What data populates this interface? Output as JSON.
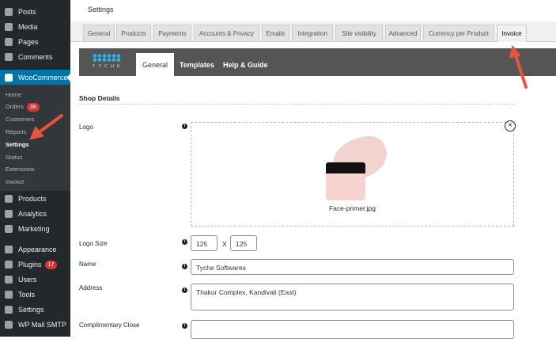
{
  "sidebar": {
    "items": [
      {
        "label": "Posts"
      },
      {
        "label": "Media"
      },
      {
        "label": "Pages"
      },
      {
        "label": "Comments"
      },
      {
        "label": "WooCommerce"
      },
      {
        "label": "Products"
      },
      {
        "label": "Analytics"
      },
      {
        "label": "Marketing"
      },
      {
        "label": "Appearance"
      },
      {
        "label": "Plugins",
        "badge": "17"
      },
      {
        "label": "Users"
      },
      {
        "label": "Tools"
      },
      {
        "label": "Settings"
      },
      {
        "label": "WP Mail SMTP"
      }
    ],
    "submenu": [
      {
        "label": "Home"
      },
      {
        "label": "Orders",
        "badge": "38"
      },
      {
        "label": "Customers"
      },
      {
        "label": "Reports"
      },
      {
        "label": "Settings"
      },
      {
        "label": "Status"
      },
      {
        "label": "Extensions"
      },
      {
        "label": "Invoice"
      }
    ]
  },
  "header": {
    "title": "Settings"
  },
  "tabs": [
    {
      "label": "General"
    },
    {
      "label": "Products"
    },
    {
      "label": "Payments"
    },
    {
      "label": "Accounts & Privacy"
    },
    {
      "label": "Emails"
    },
    {
      "label": "Integration"
    },
    {
      "label": "Site visibility"
    },
    {
      "label": "Advanced"
    },
    {
      "label": "Currency per Product"
    },
    {
      "label": "Invoice"
    }
  ],
  "plugin": {
    "logo_text": "TYCHE",
    "subtabs": [
      {
        "label": "General"
      },
      {
        "label": "Templates"
      },
      {
        "label": "Help & Guide"
      }
    ]
  },
  "form": {
    "section": "Shop Details",
    "logo_label": "Logo",
    "logo_file": "Face-primer.jpg",
    "logo_size_label": "Logo Size",
    "width": "125",
    "sep": "X",
    "height": "125",
    "name_label": "Name",
    "name": "Tyche Softwares",
    "address_label": "Address",
    "address": "Thakur Complex, Kandivali (East)",
    "close_label": "Complimentary Close",
    "close": ""
  },
  "colors": {
    "accent": "#0073aa",
    "arrow": "#e8533f"
  }
}
